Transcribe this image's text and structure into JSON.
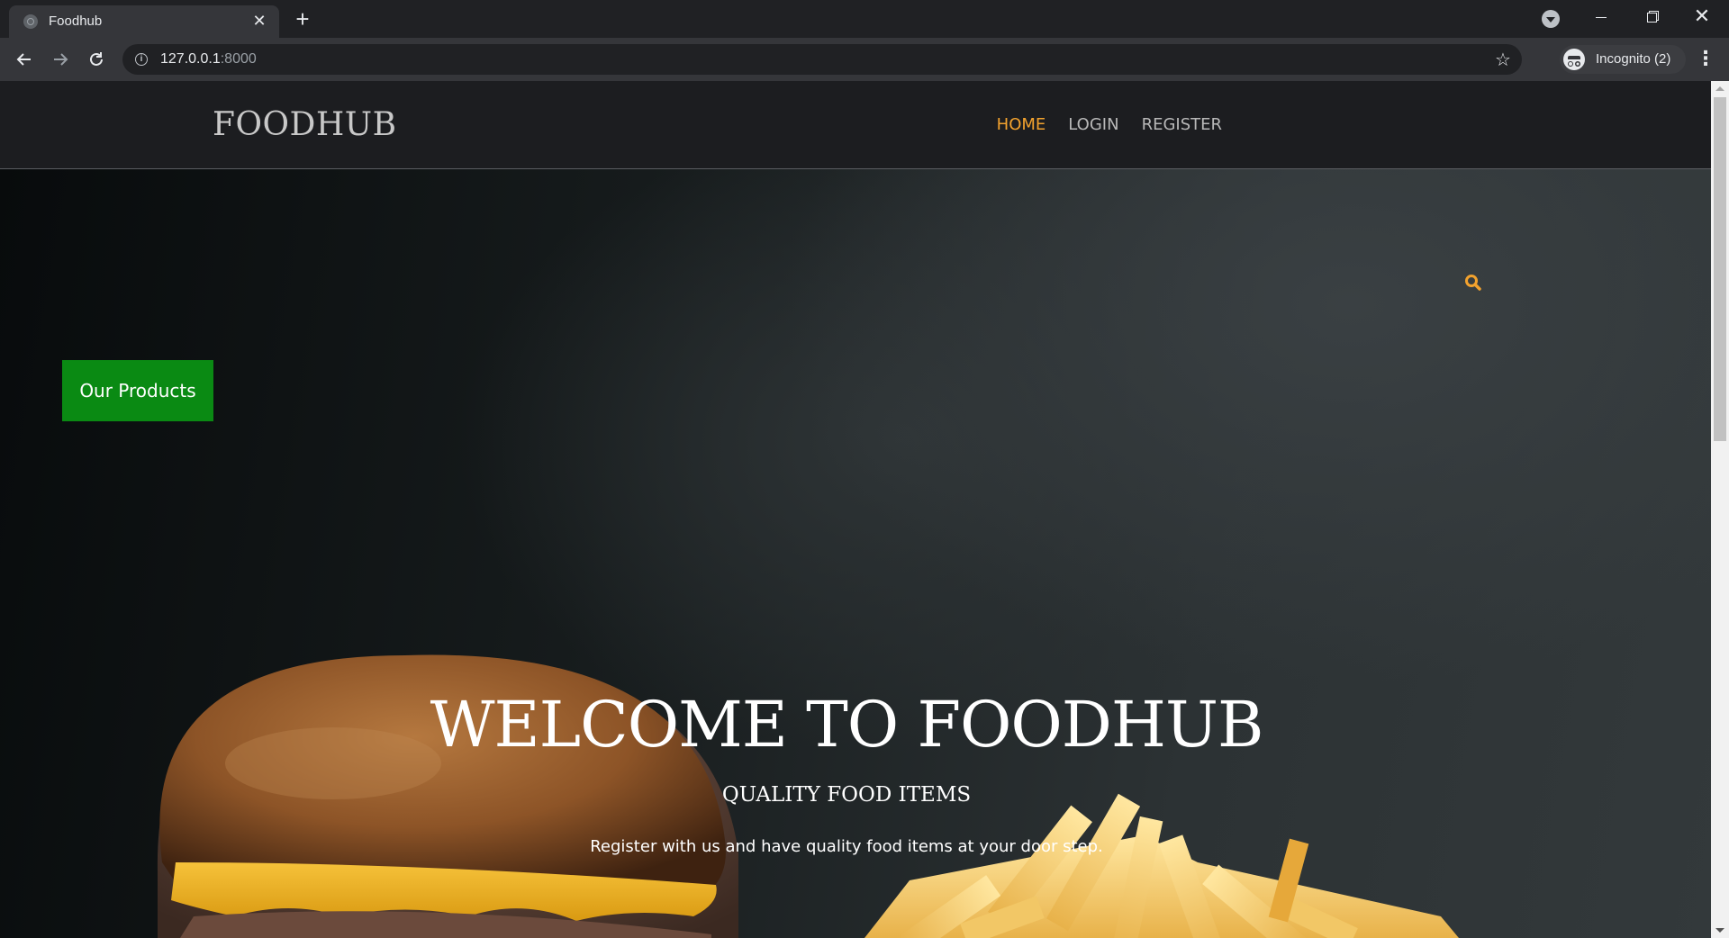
{
  "browser": {
    "tab_title": "Foodhub",
    "tab_close": "✕",
    "new_tab": "+",
    "url_host": "127.0.0.1",
    "url_port": ":8000",
    "profile_label": "Incognito (2)",
    "icons": [
      "globe-icon",
      "close-icon",
      "plus-icon",
      "tab-search-icon",
      "minimize-icon",
      "maximize-icon",
      "window-close-icon",
      "back-arrow-icon",
      "forward-arrow-icon",
      "reload-icon",
      "info-icon",
      "star-icon",
      "incognito-icon",
      "kebab-menu-icon"
    ]
  },
  "site": {
    "brand": "FOODHUB",
    "nav": [
      {
        "label": "HOME",
        "active": true
      },
      {
        "label": "LOGIN",
        "active": false
      },
      {
        "label": "REGISTER",
        "active": false
      }
    ],
    "accent_color": "#f2a22e",
    "products_button": "Our Products",
    "products_button_color": "#0a8a13"
  },
  "hero": {
    "title": "WELCOME TO FOODHUB",
    "subtitle": "QUALITY FOOD ITEMS",
    "text": "Register with us and have quality food items at your door step."
  }
}
